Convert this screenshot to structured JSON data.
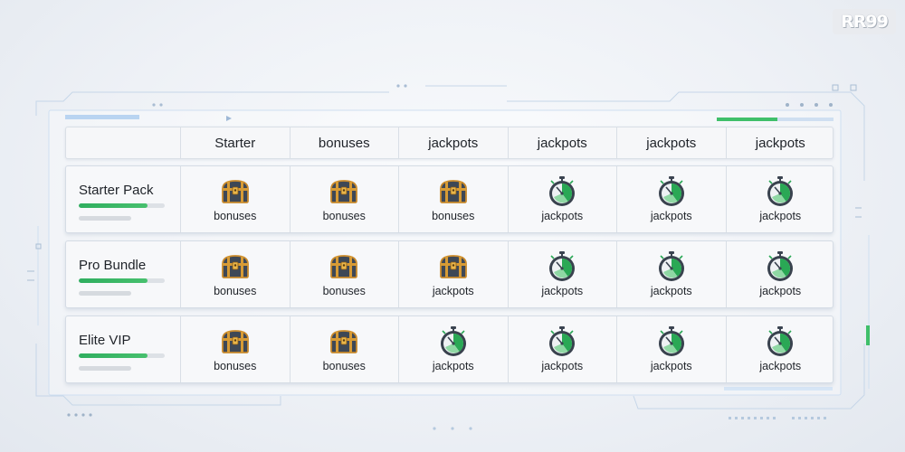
{
  "brand": {
    "logo_text": "RR99"
  },
  "table": {
    "columns": [
      "Starter",
      "bonuses",
      "jackpots",
      "jackpots",
      "jackpots",
      "jackpots"
    ],
    "rows": [
      {
        "label": "Starter Pack",
        "progress": 0.8,
        "cells": [
          {
            "icon": "treasure-chest-icon",
            "label": "bonuses"
          },
          {
            "icon": "treasure-chest-icon",
            "label": "bonuses"
          },
          {
            "icon": "treasure-chest-icon",
            "label": "bonuses"
          },
          {
            "icon": "stopwatch-icon",
            "label": "jackpots"
          },
          {
            "icon": "stopwatch-icon",
            "label": "jackpots"
          },
          {
            "icon": "stopwatch-icon",
            "label": "jackpots"
          }
        ]
      },
      {
        "label": "Pro Bundle",
        "progress": 0.8,
        "cells": [
          {
            "icon": "treasure-chest-icon",
            "label": "bonuses"
          },
          {
            "icon": "treasure-chest-icon",
            "label": "bonuses"
          },
          {
            "icon": "treasure-chest-icon",
            "label": "jackpots"
          },
          {
            "icon": "stopwatch-icon",
            "label": "jackpots"
          },
          {
            "icon": "stopwatch-icon",
            "label": "jackpots"
          },
          {
            "icon": "stopwatch-icon",
            "label": "jackpots"
          }
        ]
      },
      {
        "label": "Elite VIP",
        "progress": 0.8,
        "cells": [
          {
            "icon": "treasure-chest-icon",
            "label": "bonuses"
          },
          {
            "icon": "treasure-chest-icon",
            "label": "bonuses"
          },
          {
            "icon": "stopwatch-icon",
            "label": "jackpots"
          },
          {
            "icon": "stopwatch-icon",
            "label": "jackpots"
          },
          {
            "icon": "stopwatch-icon",
            "label": "jackpots"
          },
          {
            "icon": "stopwatch-icon",
            "label": "jackpots"
          }
        ]
      }
    ]
  },
  "colors": {
    "accent_green": "#2fae5f",
    "frame_blue": "#bcd4ee",
    "chest_wood": "#c98a2c",
    "chest_metal": "#3e4856"
  }
}
